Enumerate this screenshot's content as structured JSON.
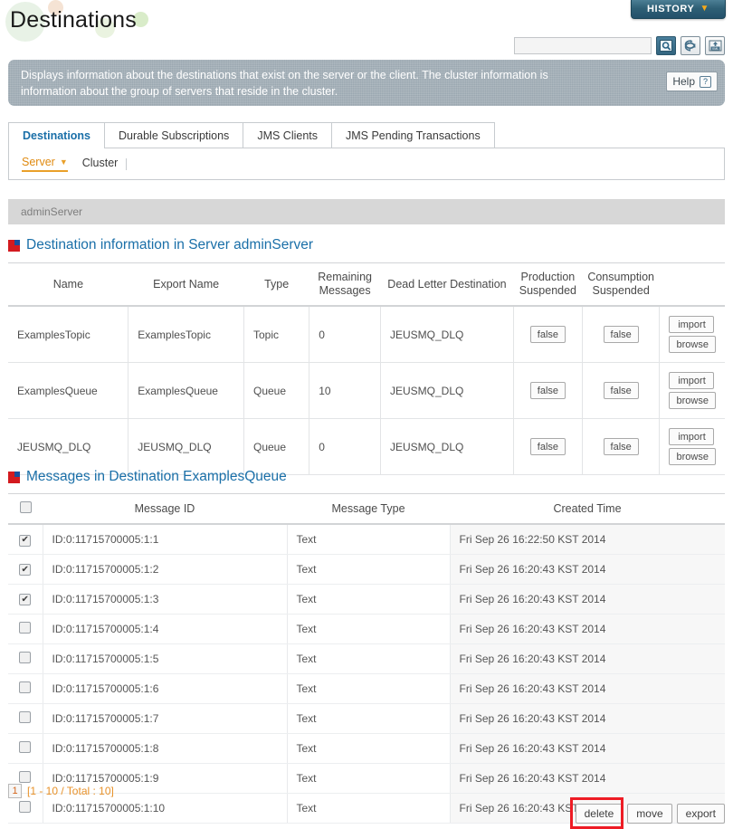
{
  "header": {
    "title": "Destinations",
    "history_label": "HISTORY",
    "history_icon": "chevron-down-icon",
    "search_placeholder": "",
    "search_value": "",
    "search_icon": "search-icon",
    "refresh_icon": "refresh-icon",
    "xml_icon": "xml-export-icon"
  },
  "info": {
    "text": "Displays information about the destinations that exist on the server or the client. The cluster information is information about the group of servers that reside in the cluster.",
    "help_label": "Help",
    "help_icon": "question-mark-icon"
  },
  "tabs": [
    {
      "label": "Destinations",
      "active": true
    },
    {
      "label": "Durable Subscriptions",
      "active": false
    },
    {
      "label": "JMS Clients",
      "active": false
    },
    {
      "label": "JMS Pending Transactions",
      "active": false
    }
  ],
  "subnav": [
    {
      "label": "Server",
      "active": true,
      "icon": "chevron-down-icon"
    },
    {
      "label": "Cluster",
      "active": false
    }
  ],
  "server_bar": {
    "name": "adminServer"
  },
  "destinations_section": {
    "heading": "Destination information in Server adminServer",
    "bullet_icon": "section-marker-icon",
    "columns": [
      "Name",
      "Export Name",
      "Type",
      "Remaining\nMessages",
      "Dead Letter Destination",
      "Production\nSuspended",
      "Consumption\nSuspended",
      ""
    ],
    "columns_display": {
      "name": "Name",
      "export_name": "Export Name",
      "type": "Type",
      "remaining_messages_l1": "Remaining",
      "remaining_messages_l2": "Messages",
      "dead_letter": "Dead Letter Destination",
      "production_l1": "Production",
      "production_l2": "Suspended",
      "consumption_l1": "Consumption",
      "consumption_l2": "Suspended"
    },
    "rows": [
      {
        "name": "ExamplesTopic",
        "export_name": "ExamplesTopic",
        "type": "Topic",
        "remaining_messages": "0",
        "dead_letter_destination": "JEUSMQ_DLQ",
        "production_suspended": "false",
        "consumption_suspended": "false",
        "import_label": "import",
        "browse_label": "browse"
      },
      {
        "name": "ExamplesQueue",
        "export_name": "ExamplesQueue",
        "type": "Queue",
        "remaining_messages": "10",
        "dead_letter_destination": "JEUSMQ_DLQ",
        "production_suspended": "false",
        "consumption_suspended": "false",
        "import_label": "import",
        "browse_label": "browse"
      },
      {
        "name": "JEUSMQ_DLQ",
        "export_name": "JEUSMQ_DLQ",
        "type": "Queue",
        "remaining_messages": "0",
        "dead_letter_destination": "JEUSMQ_DLQ",
        "production_suspended": "false",
        "consumption_suspended": "false",
        "import_label": "import",
        "browse_label": "browse"
      }
    ]
  },
  "messages_section": {
    "heading": "Messages in Destination ExamplesQueue",
    "bullet_icon": "section-marker-icon",
    "columns": {
      "select_all": "",
      "message_id": "Message ID",
      "message_type": "Message Type",
      "created_time": "Created Time"
    },
    "select_all_checked": false,
    "rows": [
      {
        "checked": true,
        "message_id": "ID:0:11715700005:1:1",
        "message_type": "Text",
        "created_time": "Fri Sep 26 16:22:50 KST 2014"
      },
      {
        "checked": true,
        "message_id": "ID:0:11715700005:1:2",
        "message_type": "Text",
        "created_time": "Fri Sep 26 16:20:43 KST 2014"
      },
      {
        "checked": true,
        "message_id": "ID:0:11715700005:1:3",
        "message_type": "Text",
        "created_time": "Fri Sep 26 16:20:43 KST 2014"
      },
      {
        "checked": false,
        "message_id": "ID:0:11715700005:1:4",
        "message_type": "Text",
        "created_time": "Fri Sep 26 16:20:43 KST 2014"
      },
      {
        "checked": false,
        "message_id": "ID:0:11715700005:1:5",
        "message_type": "Text",
        "created_time": "Fri Sep 26 16:20:43 KST 2014"
      },
      {
        "checked": false,
        "message_id": "ID:0:11715700005:1:6",
        "message_type": "Text",
        "created_time": "Fri Sep 26 16:20:43 KST 2014"
      },
      {
        "checked": false,
        "message_id": "ID:0:11715700005:1:7",
        "message_type": "Text",
        "created_time": "Fri Sep 26 16:20:43 KST 2014"
      },
      {
        "checked": false,
        "message_id": "ID:0:11715700005:1:8",
        "message_type": "Text",
        "created_time": "Fri Sep 26 16:20:43 KST 2014"
      },
      {
        "checked": false,
        "message_id": "ID:0:11715700005:1:9",
        "message_type": "Text",
        "created_time": "Fri Sep 26 16:20:43 KST 2014"
      },
      {
        "checked": false,
        "message_id": "ID:0:11715700005:1:10",
        "message_type": "Text",
        "created_time": "Fri Sep 26 16:20:43 KST 2014"
      }
    ]
  },
  "pagination": {
    "current_page": "1",
    "summary": "[1 - 10 / Total : 10]"
  },
  "footer_buttons": [
    {
      "label": "delete",
      "highlighted": true
    },
    {
      "label": "move",
      "highlighted": false
    },
    {
      "label": "export",
      "highlighted": false
    }
  ],
  "colors": {
    "accent_blue": "#1a6fa8",
    "accent_orange": "#e8922a",
    "marker_red": "#d31a1f",
    "marker_blue": "#1a4f9c",
    "info_bg": "#9aa7b0",
    "annotation_red": "#ee1c25"
  }
}
